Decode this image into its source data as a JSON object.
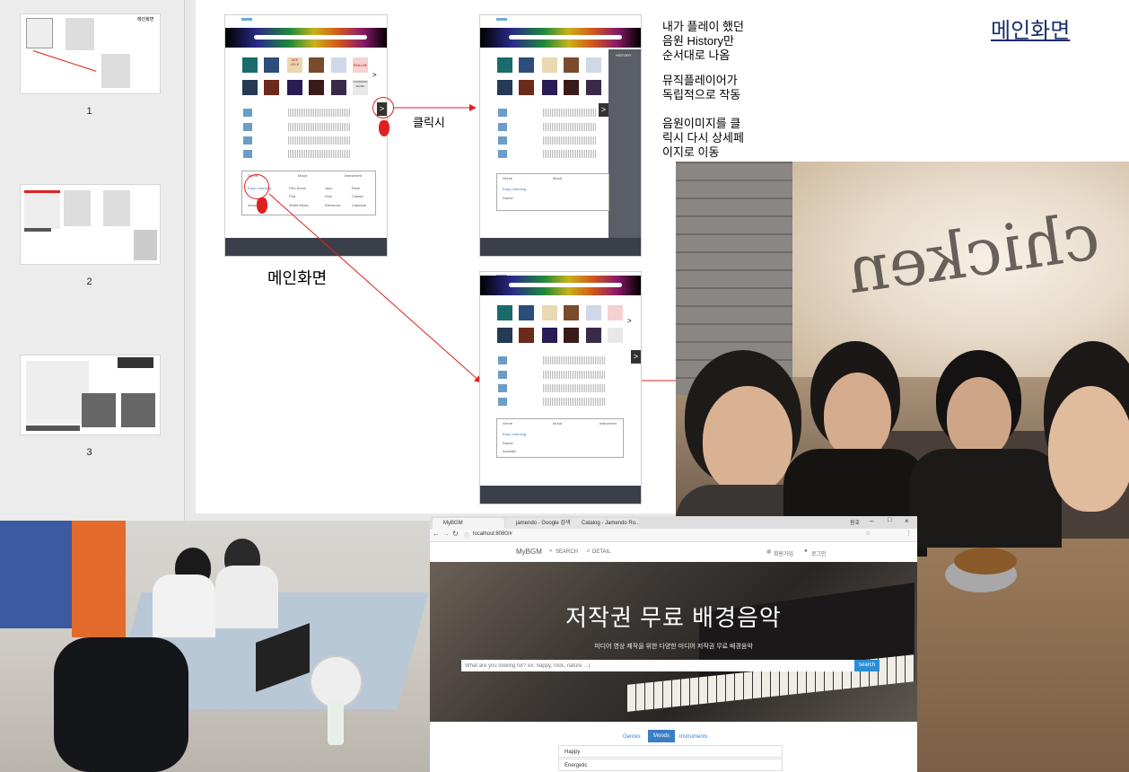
{
  "slide_panel": {
    "thumbnails": [
      {
        "number": "1",
        "title": "메인화면"
      },
      {
        "number": "2"
      },
      {
        "number": "3"
      }
    ]
  },
  "slide": {
    "title_link": "메인화면",
    "caption_main": "메인화면",
    "click_label": "클릭시",
    "notes": [
      "내가 플레이 했던\n음원 History만\n순서대로 나옴",
      "뮤직플레이어가\n독립적으로 작동",
      "음원이미지를 클\n릭시 다시 상세페\n이지로 이동"
    ],
    "mock": {
      "next_button": ">",
      "history_label": "HISTORY",
      "tab_labels": [
        "Genre",
        "Mood",
        "Instrument"
      ],
      "genre_items": [
        "Easy Listening",
        "Dance",
        "Acoustic",
        "Film Score",
        "Pop",
        "World Music",
        "Jazz",
        "Soul",
        "Electronic",
        "Rock",
        "Classic",
        "Classical"
      ],
      "album_text_ukulele": "UKE LELE",
      "album_text_rollin": "ROLLIN'",
      "album_text_changing": "CHANGING MUSIC"
    },
    "photo_text": "chicken"
  },
  "browser": {
    "tabs": [
      "MyBGM",
      "jamendo - Google 검색",
      "Catalog - Jamendo Ro..."
    ],
    "window_label": "원호",
    "url": "localhost:8080/#",
    "brand": "MyBGM",
    "nav_search": "SEARCH",
    "nav_detail": "DETAIL",
    "nav_signup": "회원가입",
    "nav_login": "로그인",
    "hero_title": "저작권 무료 배경음악",
    "hero_subtitle": "미디어 영상 제작을 위한 다양한 미디어 저작권 무료 배경음악",
    "search_placeholder": "What are you looking for? ex: happy, rock, nature ...)",
    "search_button": "search",
    "filter_tabs": [
      "Genres",
      "Moods",
      "Instruments"
    ],
    "mood_list": [
      "Happy",
      "Energetic"
    ]
  },
  "colors": {
    "title_link": "#1b2f6b",
    "annotation_red": "#e02020",
    "mock_footer": "#3a3f4a",
    "search_button": "#2a8fd6",
    "active_tab": "#3a7ec4"
  }
}
